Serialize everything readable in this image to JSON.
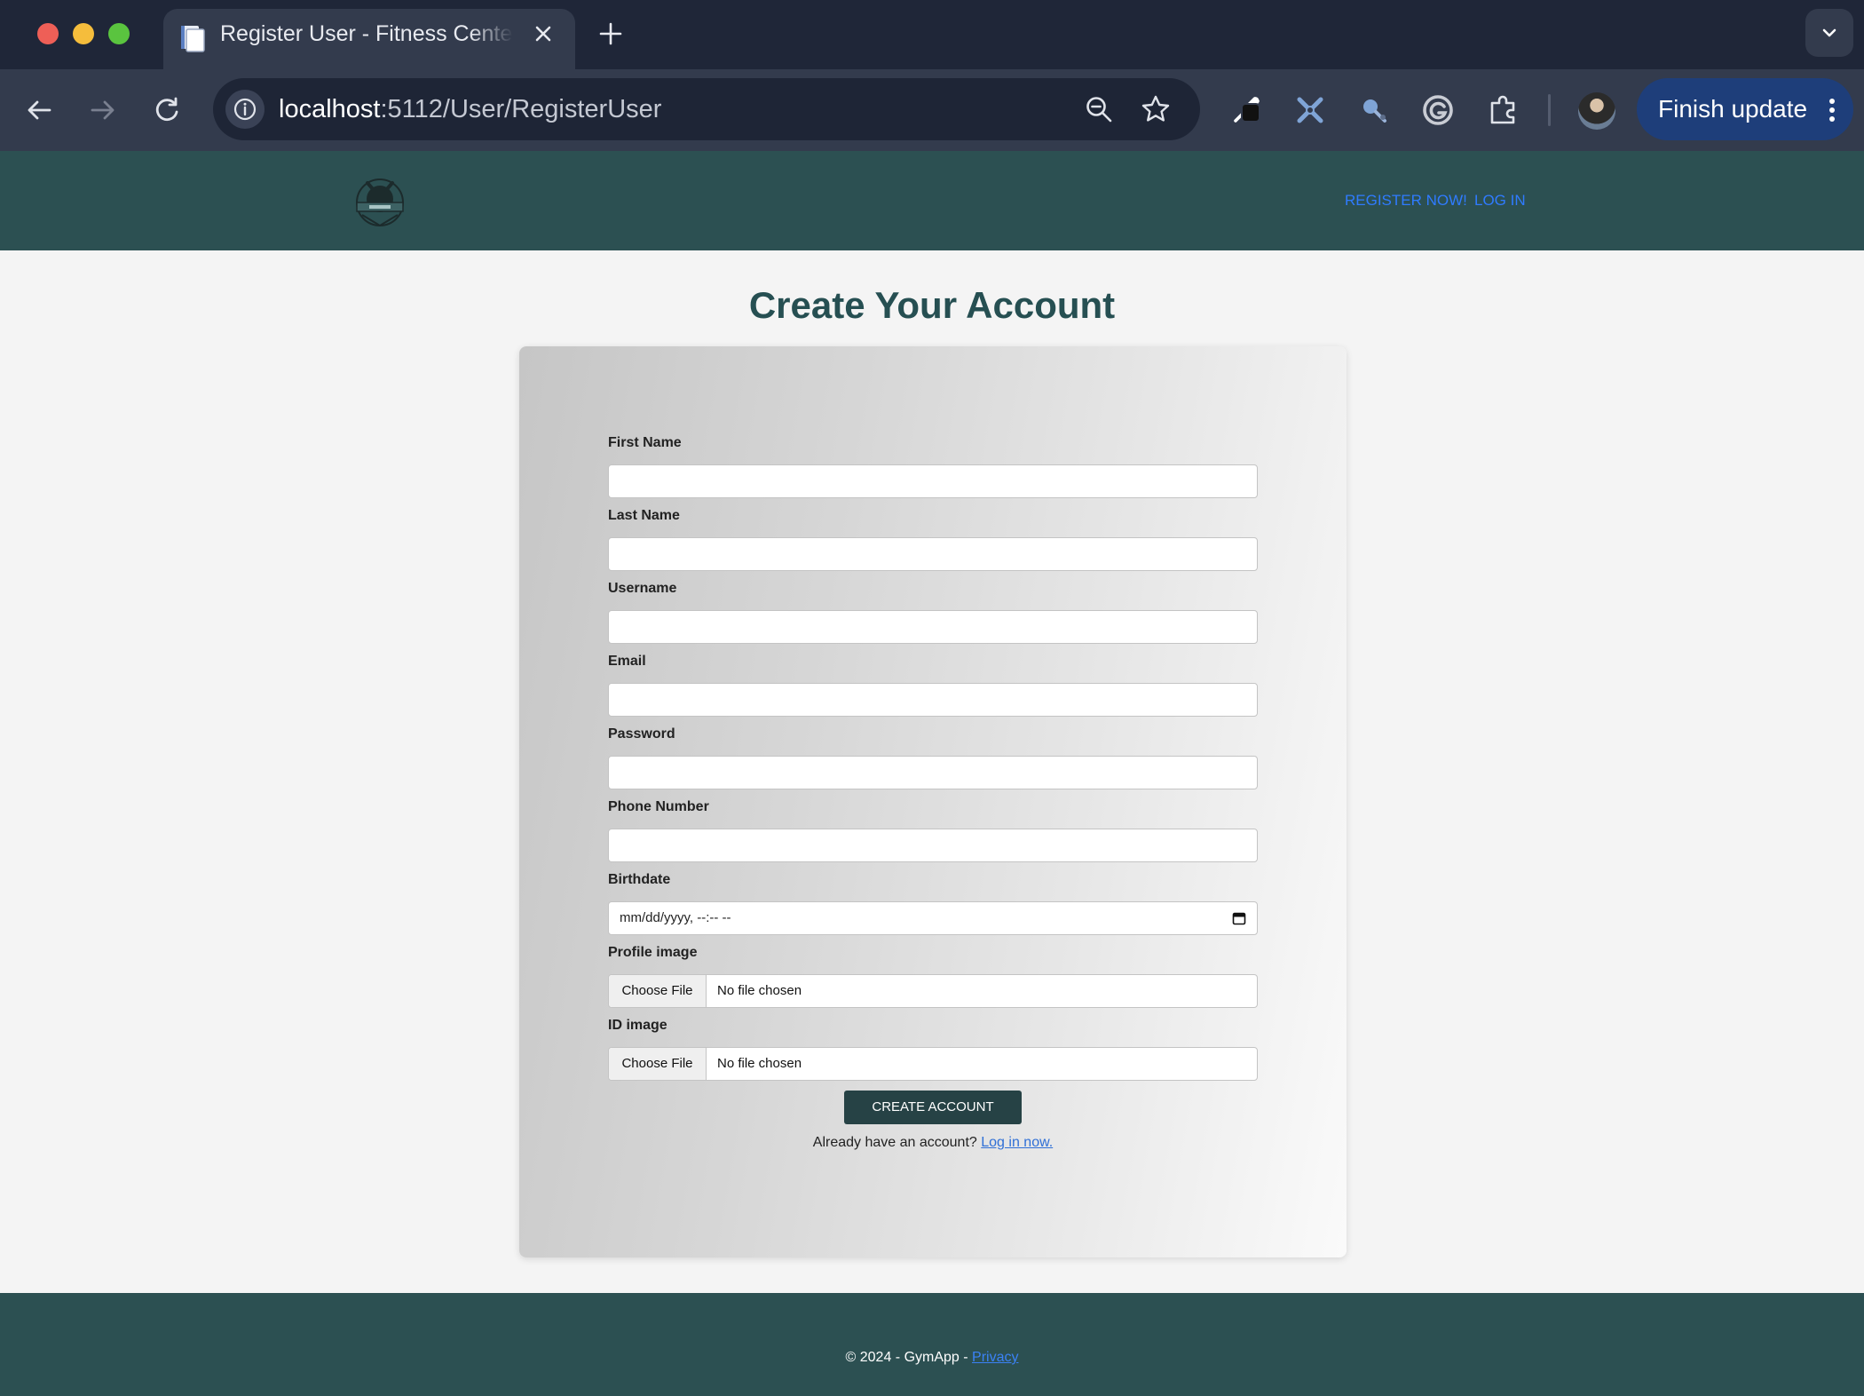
{
  "browser": {
    "tab_title": "Register User - Fitness Center",
    "url_host": "localhost",
    "url_rest": ":5112/User/RegisterUser",
    "update_label": "Finish update"
  },
  "header": {
    "nav": [
      {
        "label": "Register now!"
      },
      {
        "label": "Log in"
      }
    ]
  },
  "main": {
    "title": "Create Your Account",
    "fields": {
      "first_name": {
        "label": "First Name",
        "value": ""
      },
      "last_name": {
        "label": "Last Name",
        "value": ""
      },
      "username": {
        "label": "Username",
        "value": ""
      },
      "email": {
        "label": "Email",
        "value": ""
      },
      "password": {
        "label": "Password",
        "value": ""
      },
      "phone": {
        "label": "Phone Number",
        "value": ""
      },
      "birthdate": {
        "label": "Birthdate",
        "placeholder": "mm/dd/yyyy, --:-- --"
      },
      "profile_image": {
        "label": "Profile image",
        "button": "Choose File",
        "status": "No file chosen"
      },
      "id_image": {
        "label": "ID image",
        "button": "Choose File",
        "status": "No file chosen"
      }
    },
    "submit_label": "Create Account",
    "login_prompt": "Already have an account?",
    "login_link": "Log in now."
  },
  "footer": {
    "text": "© 2024 - GymApp - ",
    "privacy": "Privacy"
  },
  "colors": {
    "header_bg": "#2c5052",
    "title": "#264f52",
    "button": "#264245",
    "link": "#2f7bff"
  }
}
